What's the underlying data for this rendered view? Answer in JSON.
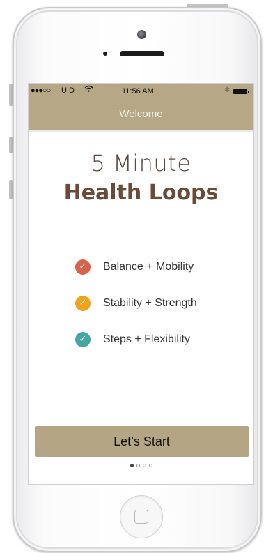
{
  "status_bar": {
    "signal": "●●●○○",
    "carrier": "UID",
    "wifi_icon": "wifi-icon",
    "time": "11:56 AM",
    "bluetooth": "✱",
    "battery_icon": "battery-icon"
  },
  "nav": {
    "title": "Welcome"
  },
  "hero": {
    "line1": "5 Minute",
    "line2": "Health Loops"
  },
  "features": [
    {
      "label": "Balance + Mobility",
      "color": "#d9624c",
      "icon": "checkmark-icon"
    },
    {
      "label": "Stability + Strength",
      "color": "#f0a31c",
      "icon": "checkmark-icon"
    },
    {
      "label": "Steps + Flexibility",
      "color": "#46a7a2",
      "icon": "checkmark-icon"
    }
  ],
  "start_button": {
    "label": "Let’s Start"
  },
  "pagination": {
    "total": 4,
    "current": 1
  },
  "colors": {
    "accent": "#b6a886",
    "title_brown": "#6b4a3a"
  }
}
